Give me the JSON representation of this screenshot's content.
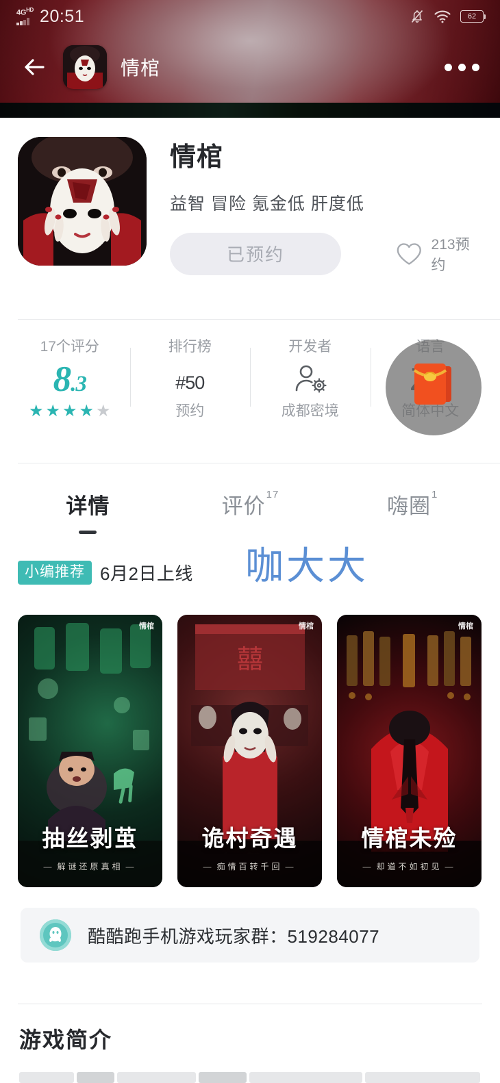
{
  "status_bar": {
    "network": "4G",
    "network_sup": "HD",
    "time": "20:51",
    "battery": "62",
    "icons": [
      "signal-bars-icon",
      "mute-bell-icon",
      "wifi-icon",
      "battery-icon"
    ]
  },
  "navbar": {
    "back_icon": "back-arrow-icon",
    "app_icon": "app-icon-thumbnail",
    "title": "情棺",
    "more_icon": "more-options-icon"
  },
  "app": {
    "name": "情棺",
    "tags": "益智 冒险 氪金低 肝度低",
    "reserve_button": "已预约",
    "favorite_icon": "heart-icon",
    "favorite_count": "213预约"
  },
  "stats": [
    {
      "label": "17个评分",
      "value": "8",
      "value_decimal": ".3",
      "sub": "",
      "type": "rating",
      "stars_filled": 4,
      "stars_total": 5
    },
    {
      "label": "排行榜",
      "hash": "#",
      "value": "50",
      "sub": "预约",
      "type": "rank"
    },
    {
      "label": "开发者",
      "value": "",
      "sub": "成都密境",
      "type": "developer",
      "icon": "developer-person-gear-icon"
    },
    {
      "label": "语言",
      "value": "ZH",
      "sub": "简体中文",
      "type": "language"
    }
  ],
  "floating_button": {
    "icon": "red-packet-icon",
    "name": "红包"
  },
  "tabs": [
    {
      "label": "详情",
      "count": "",
      "active": true
    },
    {
      "label": "评价",
      "count": "17",
      "active": false
    },
    {
      "label": "嗨圈",
      "count": "1",
      "active": false
    }
  ],
  "meta": {
    "badge": "小编推荐",
    "release": "6月2日上线",
    "watermark": "咖大大"
  },
  "screenshots": [
    {
      "title": "抽丝剥茧",
      "subtitle": "解谜还原真相",
      "watermark": "情棺"
    },
    {
      "title": "诡村奇遇",
      "subtitle": "痴情百转千回",
      "watermark": "情棺"
    },
    {
      "title": "情棺未殓",
      "subtitle": "却道不如初见",
      "watermark": "情棺"
    }
  ],
  "qq_banner": {
    "icon": "qq-penguin-icon",
    "text": "酷酷跑手机游戏玩家群：519284077"
  },
  "section": {
    "title": "游戏简介"
  },
  "colors": {
    "accent_teal": "#2ab5b2",
    "badge_teal": "#3fbbb4",
    "watermark_blue": "#5b8fd4",
    "header_red": "#7d1820",
    "button_bg": "#ececf1"
  }
}
